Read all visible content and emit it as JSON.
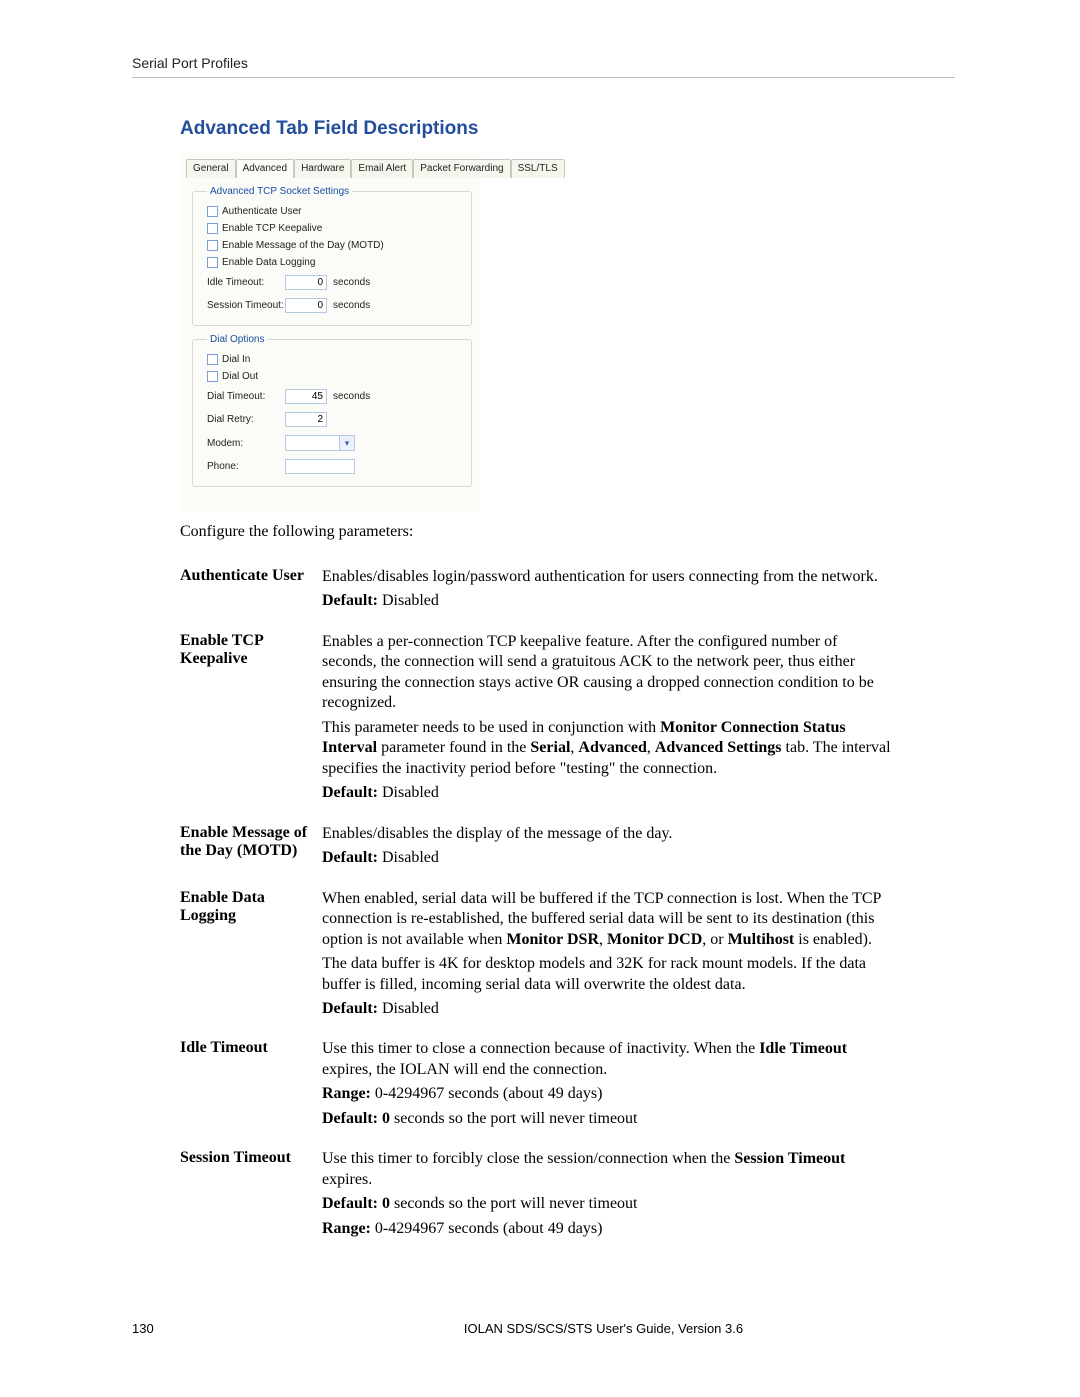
{
  "header": {
    "title": "Serial Port Profiles"
  },
  "section": {
    "title": "Advanced Tab Field Descriptions"
  },
  "panel": {
    "tabs": [
      "General",
      "Advanced",
      "Hardware",
      "Email Alert",
      "Packet Forwarding",
      "SSL/TLS"
    ],
    "active_tab_index": 1,
    "group1": {
      "legend": "Advanced TCP Socket Settings",
      "checks": [
        "Authenticate User",
        "Enable TCP Keepalive",
        "Enable Message of the Day (MOTD)",
        "Enable Data Logging"
      ],
      "idle_label": "Idle Timeout:",
      "idle_value": "0",
      "idle_suffix": "seconds",
      "sess_label": "Session Timeout:",
      "sess_value": "0",
      "sess_suffix": "seconds"
    },
    "group2": {
      "legend": "Dial Options",
      "checks": [
        "Dial In",
        "Dial Out"
      ],
      "dial_timeout_label": "Dial Timeout:",
      "dial_timeout_value": "45",
      "dial_timeout_suffix": "seconds",
      "dial_retry_label": "Dial Retry:",
      "dial_retry_value": "2",
      "modem_label": "Modem:",
      "phone_label": "Phone:"
    }
  },
  "intro": "Configure the following parameters:",
  "fields": {
    "auth": {
      "term": "Authenticate User",
      "p1": "Enables/disables login/password authentication for users connecting from the network.",
      "def_label": "Default:",
      "def_val": " Disabled"
    },
    "keepalive": {
      "term": "Enable TCP Keepalive",
      "p1": "Enables a per-connection TCP keepalive feature. After the configured number of seconds, the connection will send a gratuitous ACK to the network peer, thus either ensuring the connection stays active OR causing a dropped connection condition to be recognized.",
      "p2a": "This parameter needs to be used in conjunction with ",
      "p2b": "Monitor Connection Status Interval",
      "p2c": " parameter found in the ",
      "p2d": "Serial",
      "p2e": ", ",
      "p2f": "Advanced",
      "p2g": ", ",
      "p2h": "Advanced Settings",
      "p2i": " tab. The interval specifies the inactivity period before \"testing\" the connection.",
      "def_label": "Default:",
      "def_val": " Disabled"
    },
    "motd": {
      "term": "Enable Message of the Day (MOTD)",
      "p1": "Enables/disables the display of the message of the day.",
      "def_label": "Default:",
      "def_val": " Disabled"
    },
    "datalog": {
      "term": "Enable Data Logging",
      "p1a": "When enabled, serial data will be buffered if the TCP connection is lost. When the TCP connection is re-established, the buffered serial data will be sent to its destination (this option is not available when ",
      "p1b": "Monitor DSR",
      "p1c": ", ",
      "p1d": "Monitor DCD",
      "p1e": ", or ",
      "p1f": "Multihost",
      "p1g": " is enabled).",
      "p2": "The data buffer is 4K for desktop models and 32K for rack mount models. If the data buffer is filled, incoming serial data will overwrite the oldest data.",
      "def_label": "Default:",
      "def_val": " Disabled"
    },
    "idle": {
      "term": "Idle Timeout",
      "p1a": "Use this timer to close a connection because of inactivity. When the ",
      "p1b": "Idle Timeout",
      "p1c": " expires, the IOLAN will end the connection.",
      "range_label": "Range:",
      "range_val": " 0-4294967 seconds (about 49 days)",
      "def_label": "Default:",
      "def_val_b": " 0",
      "def_val_rest": " seconds so the port will never timeout"
    },
    "session": {
      "term": "Session Timeout",
      "p1a": "Use this timer to forcibly close the session/connection when the ",
      "p1b": "Session Timeout",
      "p1c": " expires.",
      "def_label": "Default:",
      "def_val_b": " 0",
      "def_val_rest": " seconds so the port will never timeout",
      "range_label": "Range:",
      "range_val": " 0-4294967 seconds (about 49 days)"
    }
  },
  "footer": {
    "page": "130",
    "text": "IOLAN SDS/SCS/STS User's Guide, Version 3.6"
  }
}
